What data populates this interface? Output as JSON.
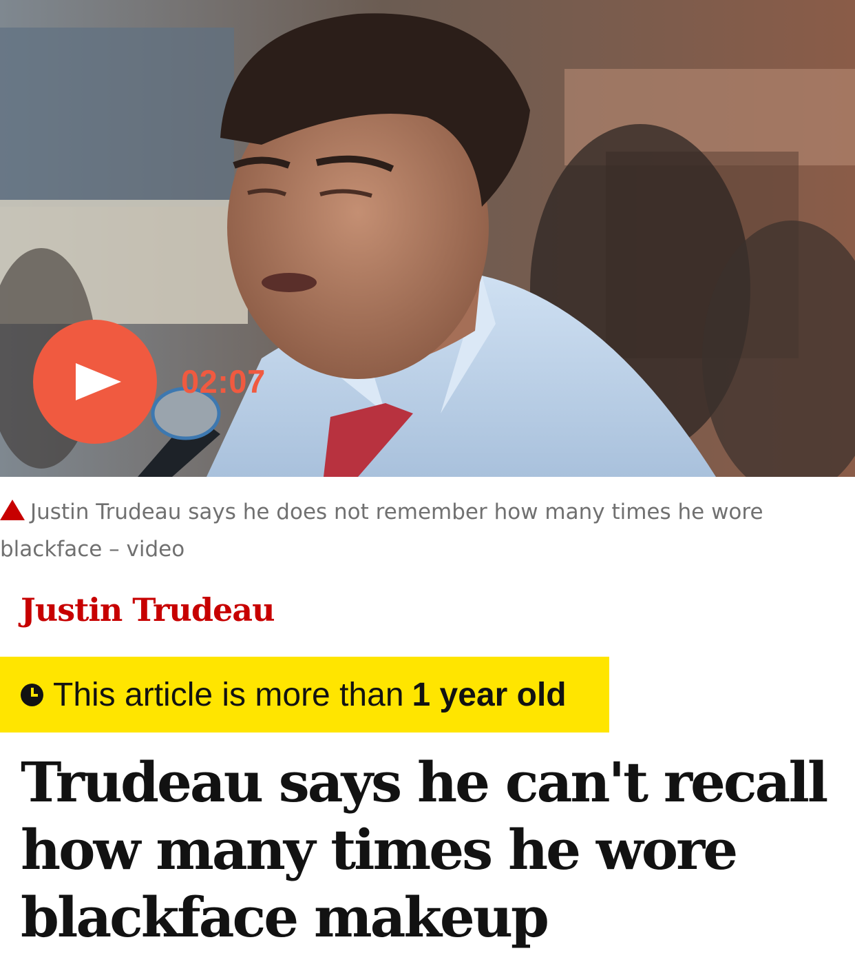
{
  "video": {
    "duration": "02:07",
    "play_icon": "play-icon",
    "play_color": "#f05a40"
  },
  "caption": {
    "icon": "triangle-icon",
    "text": "Justin Trudeau says he does not remember how many times he wore blackface – video"
  },
  "kicker": {
    "label": "Justin Trudeau",
    "color": "#c70000"
  },
  "age_warning": {
    "icon": "clock-icon",
    "prefix": "This article is more than",
    "emphasis": "1 year old",
    "background": "#ffe500"
  },
  "headline": {
    "text": "Trudeau says he can't recall how many times he wore blackface makeup"
  }
}
